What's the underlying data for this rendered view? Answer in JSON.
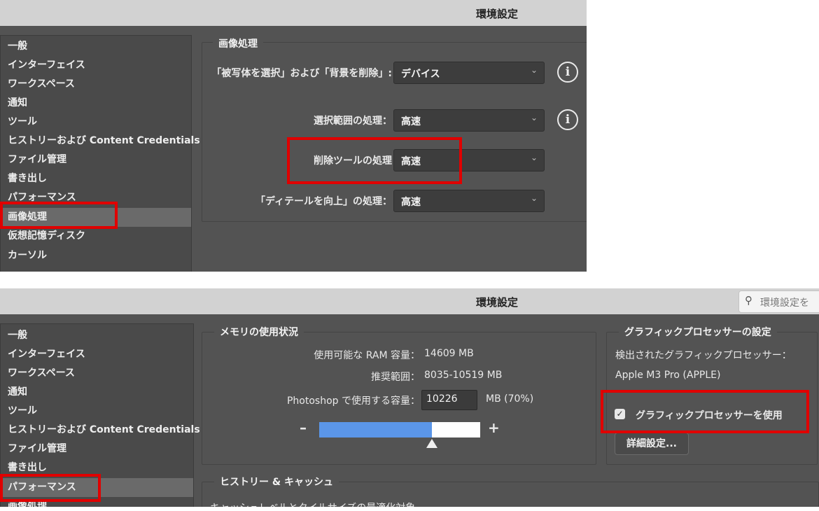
{
  "top_window": {
    "title": "環境設定",
    "sidebar": {
      "items": [
        "一般",
        "インターフェイス",
        "ワークスペース",
        "通知",
        "ツール",
        "ヒストリーおよび Content Credentials",
        "ファイル管理",
        "書き出し",
        "パフォーマンス",
        "画像処理",
        "仮想記憶ディスク",
        "カーソル"
      ],
      "selected": "画像処理"
    },
    "group_title": "画像処理",
    "rows": [
      {
        "label": "「被写体を選択」および「背景を削除」:",
        "value": "デバイス"
      },
      {
        "label": "選択範囲の処理：",
        "value": "高速"
      },
      {
        "label": "削除ツールの処理",
        "value": "高速"
      },
      {
        "label": "「ディテールを向上」の処理：",
        "value": "高速"
      }
    ],
    "info_glyph": "i"
  },
  "bottom_window": {
    "title": "環境設定",
    "search_placeholder": "環境設定を",
    "sidebar": {
      "items": [
        "一般",
        "インターフェイス",
        "ワークスペース",
        "通知",
        "ツール",
        "ヒストリーおよび Content Credentials",
        "ファイル管理",
        "書き出し",
        "パフォーマンス",
        "画像処理"
      ],
      "selected": "パフォーマンス"
    },
    "memory": {
      "title": "メモリの使用状況",
      "ram_label": "使用可能な RAM 容量：",
      "ram_value": "14609 MB",
      "range_label": "推奨範囲：",
      "range_value": "8035-10519 MB",
      "use_label": "Photoshop で使用する容量：",
      "use_value": "10226",
      "use_unit": "MB (70%)",
      "minus": "–",
      "plus": "+",
      "slider_fraction": 0.7
    },
    "gpu": {
      "title": "グラフィックプロセッサーの設定",
      "detected_label": "検出されたグラフィックプロセッサー：",
      "detected_value": "Apple M3 Pro (APPLE)",
      "use_gpu_label": "グラフィックプロセッサーを使用",
      "use_gpu_checked": true,
      "advanced_button": "詳細設定..."
    },
    "history": {
      "title": "ヒストリー & キャッシュ",
      "cut_text": "キャッシュレベルとタイルサイズの最適化対象"
    }
  },
  "colors": {
    "highlight_red": "#e00000",
    "slider_blue": "#5b96e8"
  }
}
